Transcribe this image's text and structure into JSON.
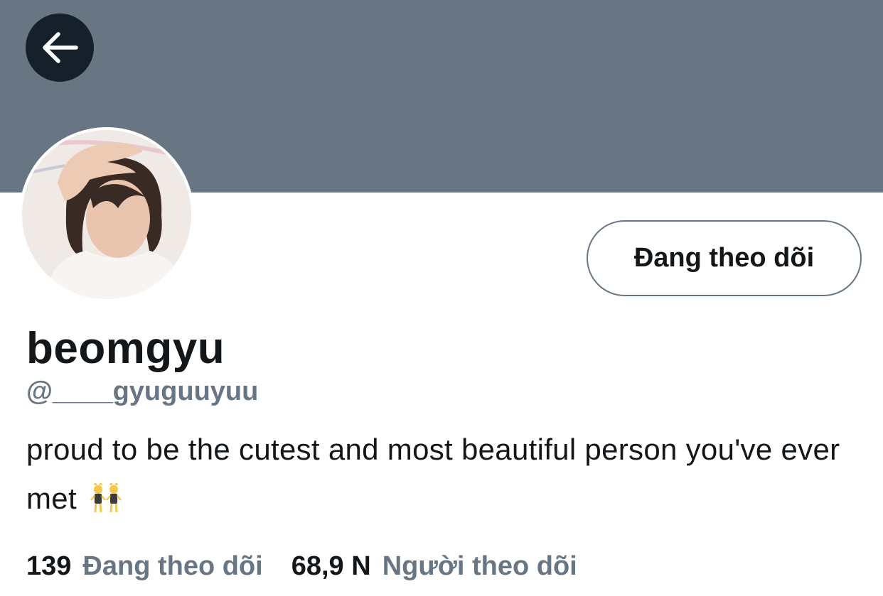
{
  "header": {
    "back_icon": "arrow-left-icon",
    "banner_color": "#687684"
  },
  "profile": {
    "follow_button_label": "Đang theo dõi",
    "name": "beomgyu",
    "handle": "@____gyuguuyuu",
    "bio": "proud to be the cutest and most beautiful person you've ever met",
    "bio_emoji": "two-cat-costume-dancers-emoji"
  },
  "stats": {
    "following_count": "139",
    "following_label": "Đang theo dõi",
    "followers_count": "68,9 N",
    "followers_label": "Người theo dõi"
  },
  "colors": {
    "text": "#14171a",
    "secondary": "#687684"
  }
}
